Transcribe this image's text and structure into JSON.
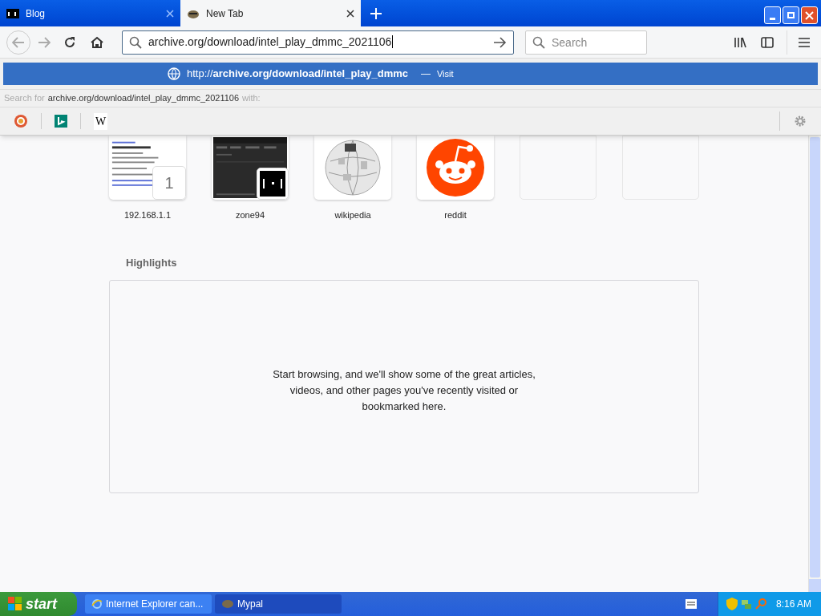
{
  "tabs": [
    {
      "label": "Blog",
      "selected": false
    },
    {
      "label": "New Tab",
      "selected": true
    }
  ],
  "url_bar": {
    "value": "archive.org/download/intel_play_dmmc_2021106"
  },
  "search": {
    "placeholder": "Search"
  },
  "suggestion": {
    "url": "http://**archive.org/download/intel_play_dmmc**",
    "separator": "—",
    "action": "Visit"
  },
  "search_for": {
    "prefix": "Search for",
    "query": "archive.org/download/intel_play_dmmc_2021106",
    "suffix": "with:"
  },
  "search_engines": [
    {
      "kind": "duckduckgo"
    },
    {
      "kind": "bing"
    },
    {
      "kind": "wikipedia",
      "label": "W"
    }
  ],
  "top_sites": [
    {
      "kind": "page",
      "label": "192.168.1.1",
      "badge": "1"
    },
    {
      "kind": "dark",
      "label": "zone94"
    },
    {
      "kind": "wikipedia",
      "label": "wikipedia"
    },
    {
      "kind": "reddit",
      "label": "reddit"
    },
    {
      "kind": "empty"
    },
    {
      "kind": "empty"
    }
  ],
  "highlights": {
    "title": "Highlights",
    "message": "Start browsing, and we'll show some of the great articles, videos, and other pages you've recently visited or bookmarked here."
  },
  "taskbar": {
    "start": "start",
    "items": [
      {
        "label": "Internet Explorer can...",
        "selected": false
      },
      {
        "label": "Mypal",
        "selected": true
      }
    ],
    "clock": "8:16 AM"
  }
}
